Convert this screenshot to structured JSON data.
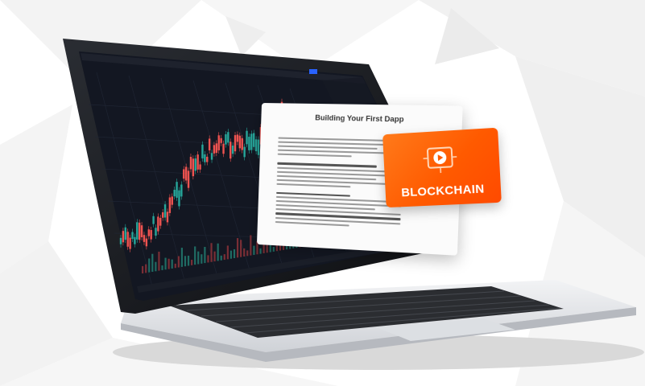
{
  "document": {
    "title": "Building Your First Dapp"
  },
  "badge": {
    "label": "BLOCKCHAIN",
    "icon": "play-icon"
  },
  "colors": {
    "badge_orange": "#ff5a00",
    "screen_dark": "#131722",
    "candle_green": "#26a69a",
    "candle_red": "#ef5350",
    "laptop_silver": "#e4e6ea"
  }
}
